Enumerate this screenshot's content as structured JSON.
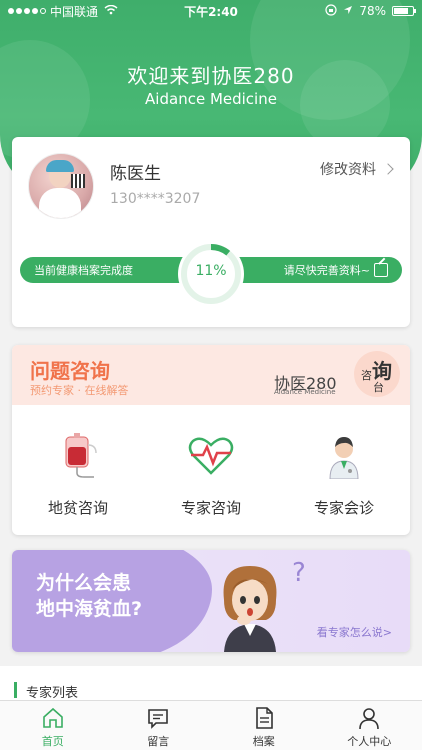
{
  "status_bar": {
    "carrier": "中国联通",
    "time": "下午2:40",
    "battery": "78%",
    "battery_level": 0.78
  },
  "header": {
    "title": "欢迎来到协医280",
    "subtitle": "Aidance Medicine"
  },
  "profile": {
    "name": "陈医生",
    "phone": "130****3207",
    "edit_label": "修改资料",
    "completion_label": "当前健康档案完成度",
    "completion_value": "11%",
    "completion_fraction": 0.11,
    "complete_prompt": "请尽快完善资料~"
  },
  "consult": {
    "banner_title": "问题咨询",
    "banner_subtitle": "预约专家 · 在线解答",
    "brand": "协医280",
    "brand_en": "Aidance Medicine",
    "badge_chars": [
      "询",
      "咨",
      "台"
    ],
    "services": [
      {
        "label": "地贫咨询",
        "icon": "blood-bag-icon"
      },
      {
        "label": "专家咨询",
        "icon": "heart-pulse-icon"
      },
      {
        "label": "专家会诊",
        "icon": "doctor-icon"
      }
    ]
  },
  "promo": {
    "line1": "为什么会患",
    "line2": "地中海贫血?",
    "question_mark": "?",
    "more": "看专家怎么说>"
  },
  "experts": {
    "title": "专家列表"
  },
  "tabs": [
    {
      "label": "首页",
      "icon": "home-icon",
      "active": true
    },
    {
      "label": "留言",
      "icon": "message-icon",
      "active": false
    },
    {
      "label": "档案",
      "icon": "document-icon",
      "active": false
    },
    {
      "label": "个人中心",
      "icon": "person-icon",
      "active": false
    }
  ],
  "colors": {
    "brand_green": "#3aae63",
    "consult_orange": "#f0734b",
    "promo_purple": "#b7a2e3"
  }
}
